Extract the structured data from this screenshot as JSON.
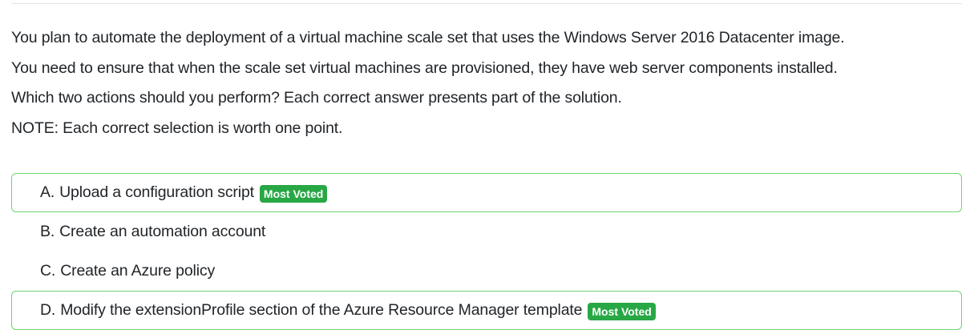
{
  "question": {
    "lines": [
      "You plan to automate the deployment of a virtual machine scale set that uses the Windows Server 2016 Datacenter image.",
      "You need to ensure that when the scale set virtual machines are provisioned, they have web server components installed.",
      "Which two actions should you perform? Each correct answer presents part of the solution.",
      "NOTE: Each correct selection is worth one point."
    ]
  },
  "choices": [
    {
      "letter": "A.",
      "text": "Upload a configuration script",
      "badge": "Most Voted"
    },
    {
      "letter": "B.",
      "text": "Create an automation account",
      "badge": ""
    },
    {
      "letter": "C.",
      "text": "Create an Azure policy",
      "badge": ""
    },
    {
      "letter": "D.",
      "text": "Modify the extensionProfile section of the Azure Resource Manager template",
      "badge": "Most Voted"
    }
  ],
  "colors": {
    "badge_background": "#28a745",
    "correct_border": "#6fd36f",
    "text": "#212529"
  }
}
